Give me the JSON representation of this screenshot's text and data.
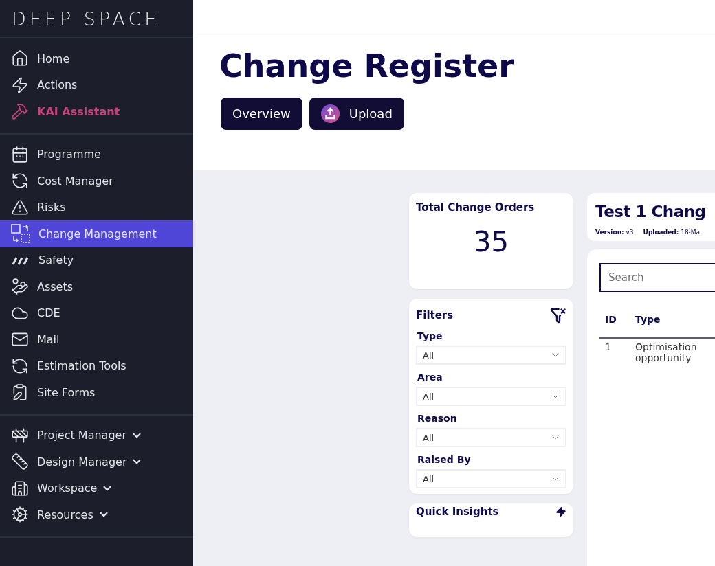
{
  "sidebar": {
    "logo": "DEEP SPACE",
    "groups": [
      {
        "items": [
          {
            "label": "Home",
            "kind": "link",
            "selected": false
          },
          {
            "label": "Actions",
            "kind": "link",
            "selected": false
          },
          {
            "label": "KAI Assistant",
            "kind": "assistant",
            "selected": false
          }
        ]
      },
      {
        "items": [
          {
            "label": "Programme",
            "kind": "link",
            "selected": false
          },
          {
            "label": "Cost Manager",
            "kind": "link",
            "selected": false
          },
          {
            "label": "Risks",
            "kind": "link",
            "selected": false
          },
          {
            "label": "Change Management",
            "kind": "link",
            "selected": true
          },
          {
            "label": "Safety",
            "kind": "link",
            "selected": false
          },
          {
            "label": "Assets",
            "kind": "link",
            "selected": false
          },
          {
            "label": "CDE",
            "kind": "link",
            "selected": false
          },
          {
            "label": "Mail",
            "kind": "link",
            "selected": false
          },
          {
            "label": "Estimation Tools",
            "kind": "link",
            "selected": false
          },
          {
            "label": "Site Forms",
            "kind": "link",
            "selected": false
          }
        ]
      },
      {
        "items": [
          {
            "label": "Project Manager",
            "kind": "menu",
            "selected": false
          },
          {
            "label": "Design Manager",
            "kind": "menu",
            "selected": false
          },
          {
            "label": "Workspace",
            "kind": "menu",
            "selected": false
          },
          {
            "label": "Resources",
            "kind": "menu",
            "selected": false
          }
        ]
      }
    ]
  },
  "page": {
    "title": "Change Register",
    "buttons": [
      "Overview",
      "Upload"
    ]
  },
  "total_card": {
    "title": "Total Change Orders",
    "value": "35"
  },
  "filters": {
    "title": "Filters",
    "fields": [
      {
        "label": "Type",
        "value": "All"
      },
      {
        "label": "Area",
        "value": "All"
      },
      {
        "label": "Reason",
        "value": "All"
      },
      {
        "label": "Raised By",
        "value": "All"
      }
    ]
  },
  "insights": {
    "title": "Quick Insights"
  },
  "register": {
    "title": "Test 1 Chang",
    "meta": [
      {
        "label": "Version:",
        "value": "v3"
      },
      {
        "label": "Uploaded:",
        "value": "18-Ma"
      }
    ],
    "search": {
      "placeholder": "Search"
    },
    "table": {
      "columns": [
        "ID",
        "Type"
      ],
      "rows": [
        [
          "1",
          "Optimisation opportunity"
        ]
      ]
    }
  }
}
